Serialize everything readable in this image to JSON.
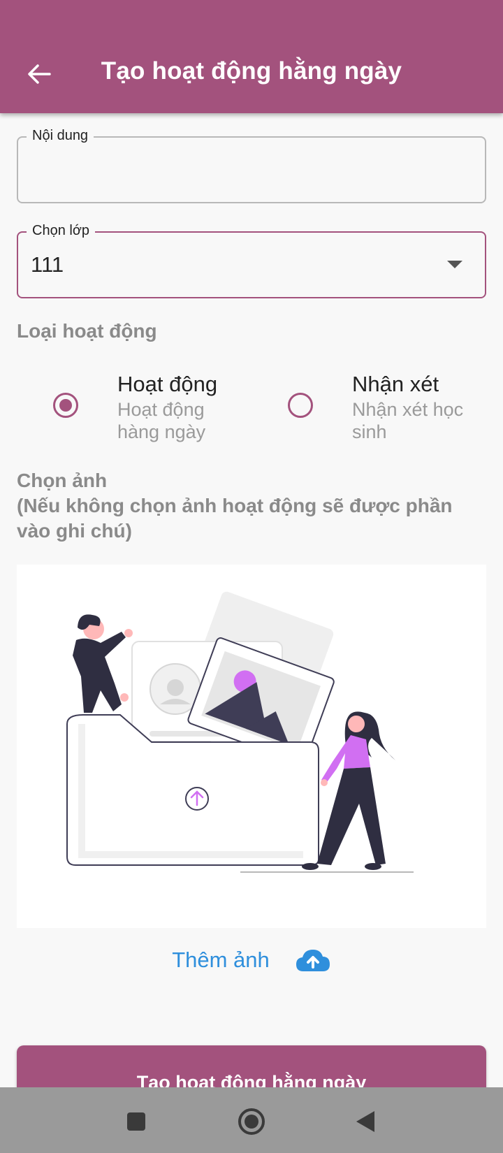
{
  "appbar": {
    "title": "Tạo hoạt động hằng ngày",
    "back_icon": "arrow-left-icon"
  },
  "form": {
    "content": {
      "label": "Nội dung",
      "value": ""
    },
    "class_select": {
      "label": "Chọn lớp",
      "value": "111"
    }
  },
  "activity_type": {
    "label": "Loại hoạt động",
    "options": [
      {
        "title": "Hoạt động",
        "subtitle": "Hoạt động hàng ngày",
        "selected": true
      },
      {
        "title": "Nhận xét",
        "subtitle": "Nhận xét học sinh",
        "selected": false
      }
    ]
  },
  "image_picker": {
    "label_line1": "Chọn ảnh",
    "label_line2": "(Nếu không chọn ảnh hoạt động sẽ được phần vào ghi chú)",
    "add_label": "Thêm ảnh",
    "upload_icon": "cloud-upload-icon"
  },
  "submit": {
    "label": "Tạo hoạt động hằng ngày"
  },
  "colors": {
    "primary": "#a3527d",
    "link": "#2f8fdc",
    "accent": "#d16ff2"
  }
}
